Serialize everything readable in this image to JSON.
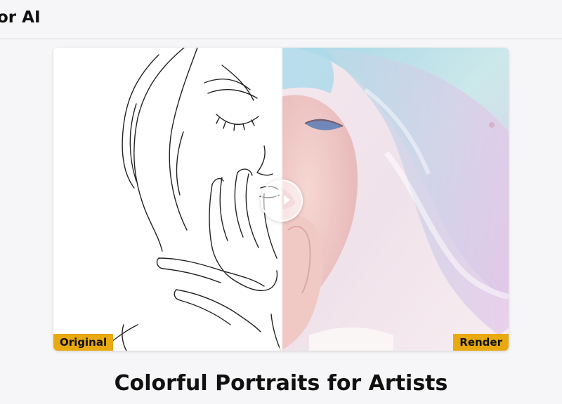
{
  "header": {
    "brand": "or AI"
  },
  "comparison": {
    "left_label": "Original",
    "right_label": "Render",
    "handle_icon_left": "arrow-left-icon",
    "handle_icon_right": "arrow-right-icon",
    "accent_color": "#e8a911"
  },
  "main": {
    "title": "Colorful Portraits for Artists"
  }
}
